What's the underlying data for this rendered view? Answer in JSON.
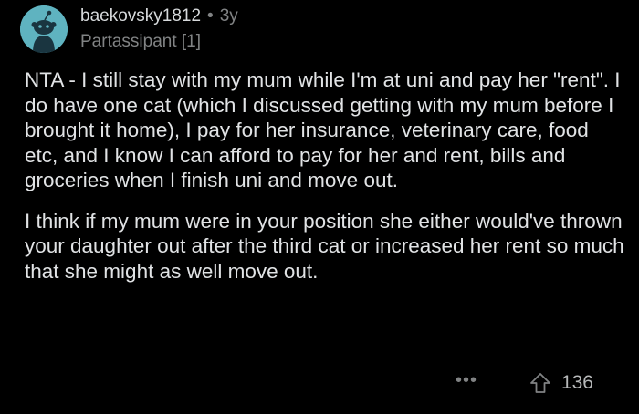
{
  "comment": {
    "author": "baekovsky1812",
    "separator": "•",
    "age": "3y",
    "flair": "Partassipant [1]",
    "paragraphs": [
      "NTA - I still stay with my mum while I'm at uni and pay her \"rent\". I do have one cat (which I discussed getting with my mum before I brought it home), I pay for her insurance, veterinary care, food etc, and I know I can afford to pay for her and rent, bills and groceries when I finish uni and move out.",
      "I think if my mum were in your position she either would've thrown your daughter out after the third cat or increased her rent so much that she might as well move out."
    ],
    "more_label": "•••",
    "upvote_count": "136"
  },
  "icons": {
    "avatar": "reddit-snoo-avatar-icon",
    "upvote": "upvote-arrow-icon",
    "more": "more-options-icon"
  },
  "colors": {
    "background": "#000000",
    "text": "#e1e3e5",
    "meta": "#818384",
    "avatar_bg": "#5fb3c0"
  }
}
